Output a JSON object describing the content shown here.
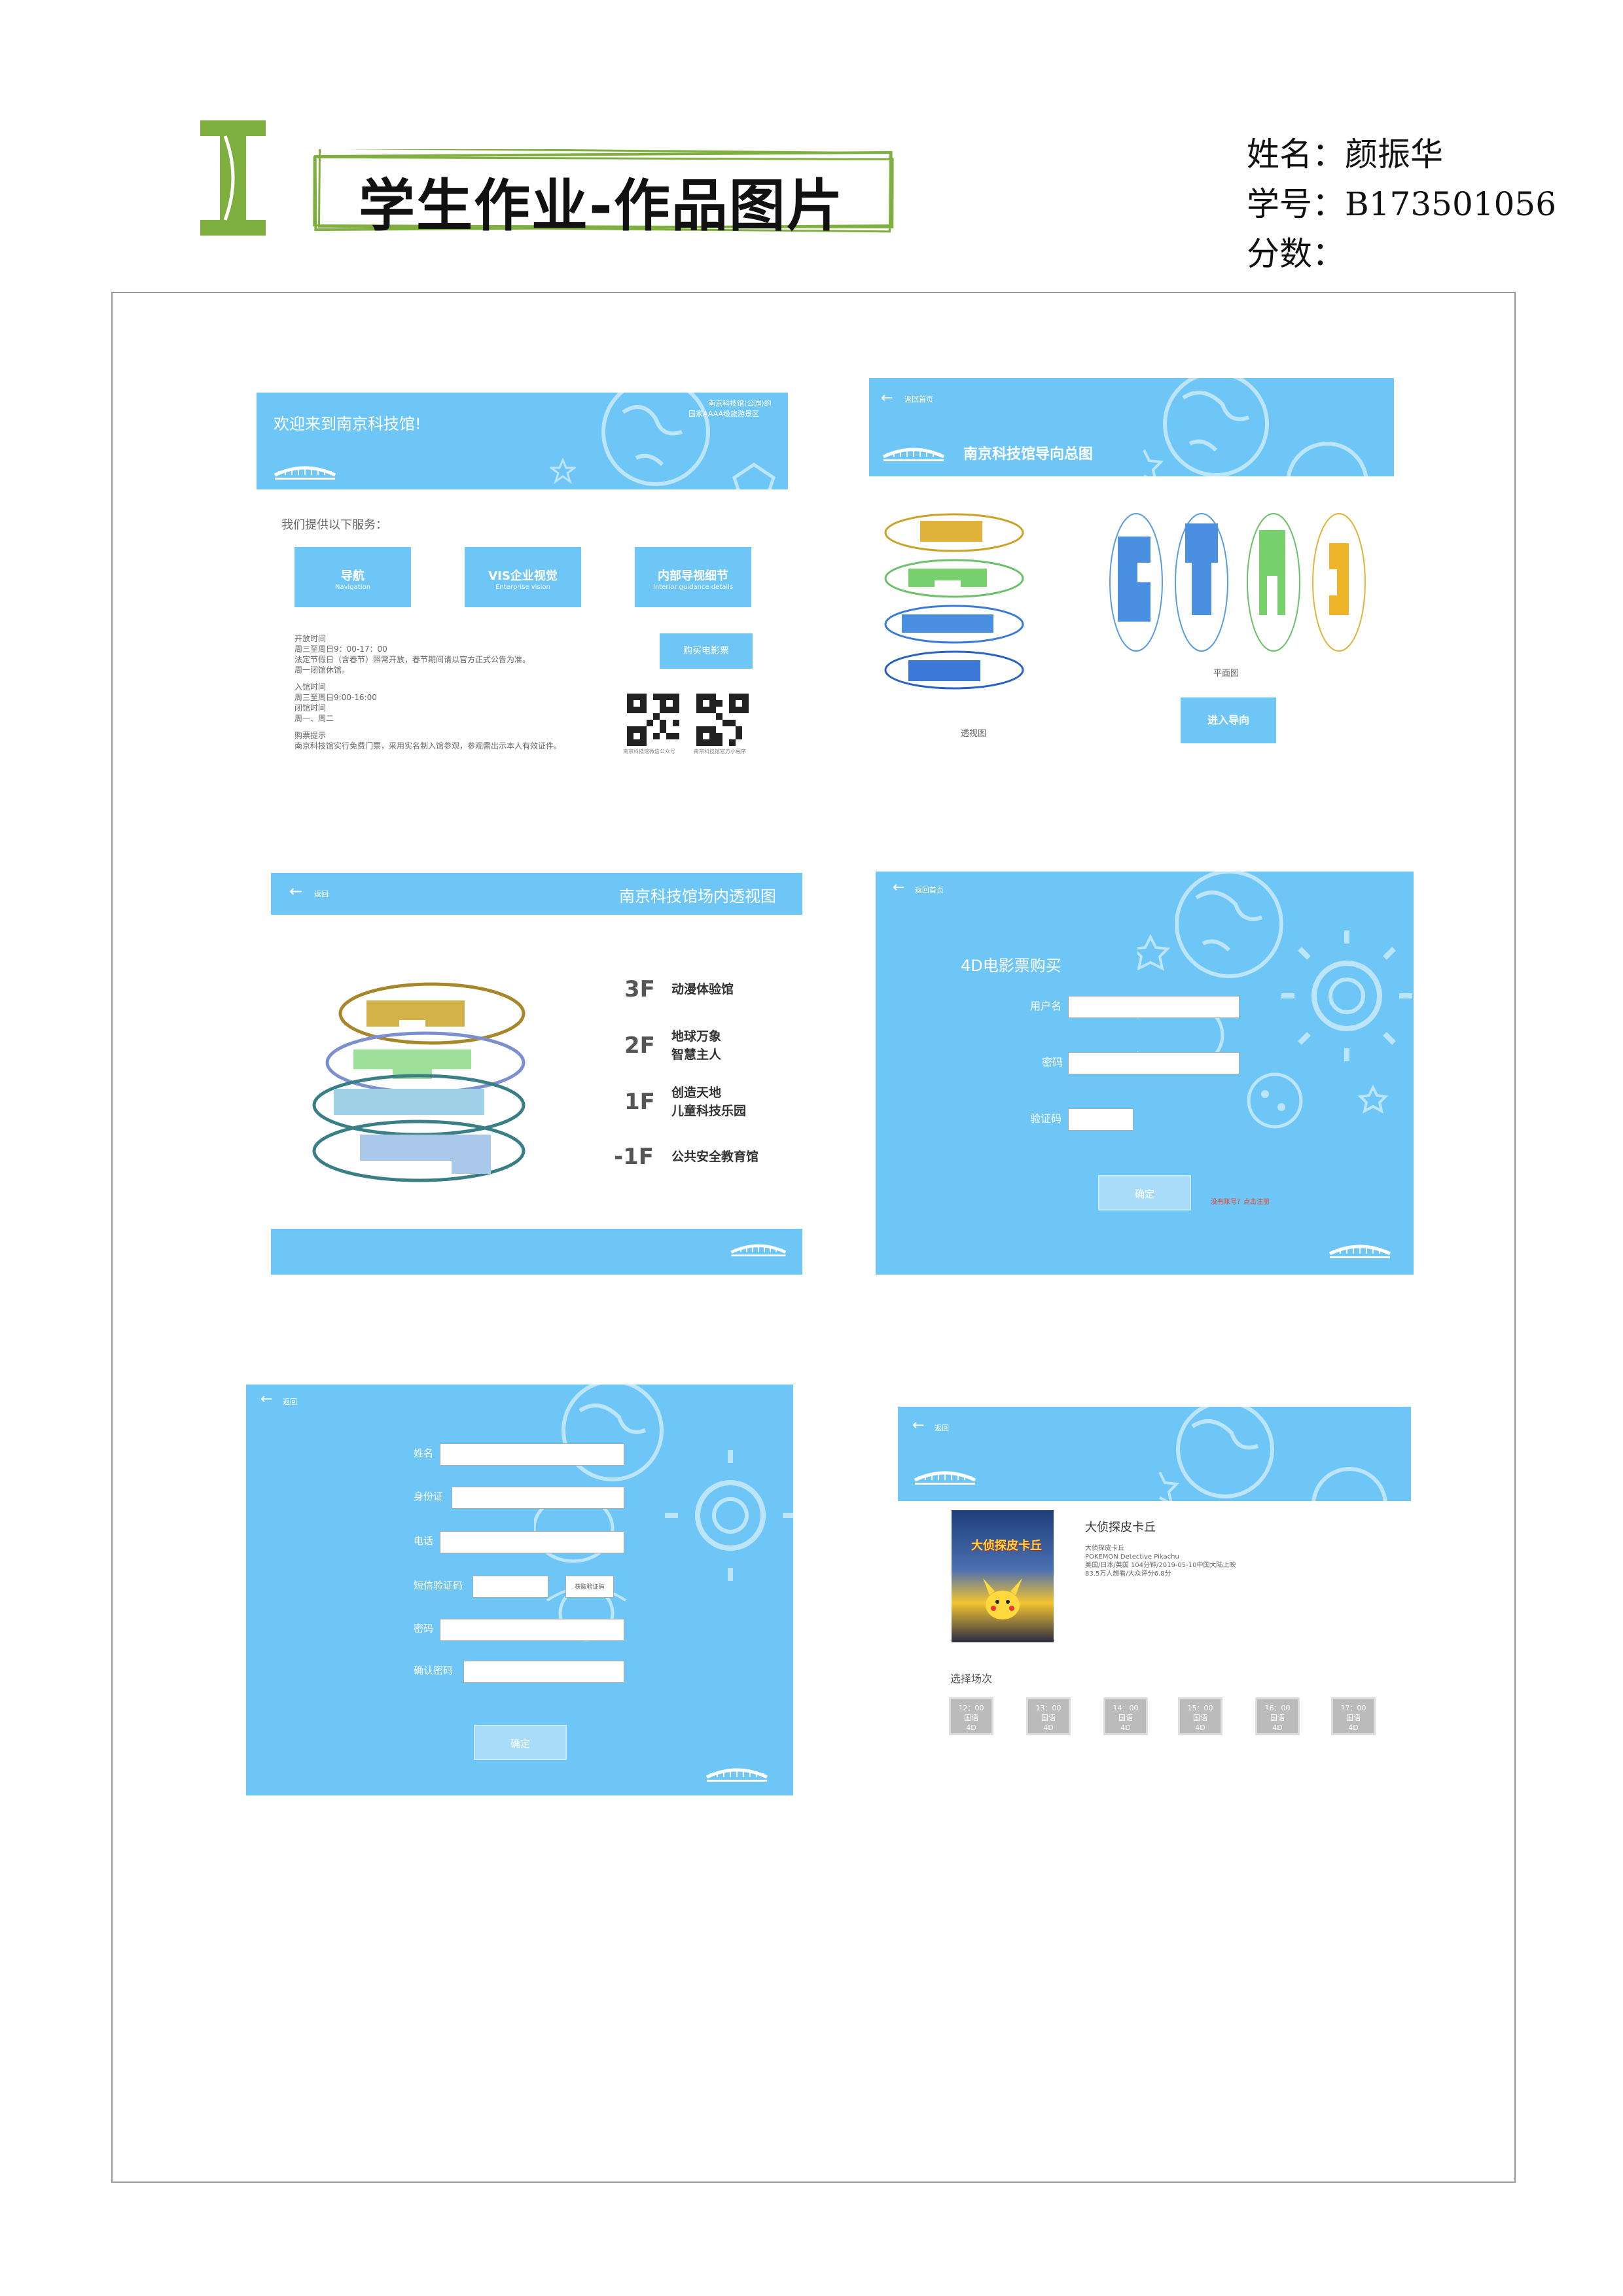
{
  "header": {
    "title": "学生作业-作品图片",
    "name_line": "姓名：颜振华",
    "id_line": "学号：B173501056",
    "score_line": "分数："
  },
  "screen1": {
    "welcome": "欢迎来到南京科技馆!",
    "corner_text_1": "南京科技馆(公园)的",
    "corner_text_2": "国家AAAA级旅游景区",
    "services_title": "我们提供以下服务：",
    "btn_nav_cn": "导航",
    "btn_nav_en": "Navigation",
    "btn_vis_cn": "VIS企业视觉",
    "btn_vis_en": "Enterprise vision",
    "btn_inner_cn": "内部导视细节",
    "btn_inner_en": "Interior guidance details",
    "btn_ticket": "购买电影票",
    "info_lines": [
      "开放时间",
      "周三至周日9：00-17：00",
      "法定节假日（含春节）照常开放，春节期间请以官方正式公告为准。",
      "周一闭馆休馆。",
      "",
      "入馆时间",
      "周三至周日9:00-16:00",
      "闭馆时间",
      "周一、周二",
      "",
      "购票提示",
      "南京科技馆实行免费门票，采用实名制入馆参观，参观需出示本人有效证件。"
    ],
    "qr_caption_1": "南京科技馆微信公众号",
    "qr_caption_2": "南京科技馆官方小程序"
  },
  "screen2": {
    "back": "返回首页",
    "title": "南京科技馆导向总图",
    "caption_left": "透视图",
    "caption_right": "平面图",
    "enter_btn": "进入导向"
  },
  "screen3": {
    "back": "返回",
    "title": "南京科技馆场内透视图",
    "floors": [
      {
        "level": "3F",
        "desc": [
          "动漫体验馆"
        ]
      },
      {
        "level": "2F",
        "desc": [
          "地球万象",
          "智慧主人"
        ]
      },
      {
        "level": "1F",
        "desc": [
          "创造天地",
          "儿童科技乐园"
        ]
      },
      {
        "level": "-1F",
        "desc": [
          "公共安全教育馆"
        ]
      }
    ]
  },
  "screen4": {
    "back": "返回首页",
    "title": "4D电影票购买",
    "username_label": "用户名",
    "password_label": "密码",
    "captcha_label": "验证码",
    "confirm_btn": "确定",
    "hint": "没有账号？点击注册"
  },
  "screen5": {
    "back": "返回",
    "name_label": "姓名",
    "idcard_label": "身份证",
    "phone_label": "电话",
    "sms_label": "短信验证码",
    "sms_btn": "获取验证码",
    "password_label": "密码",
    "confirm_password_label": "确认密码",
    "confirm_btn": "确定"
  },
  "screen6": {
    "back": "返回",
    "movie_title": "大侦探皮卡丘",
    "poster_text": "大侦探皮卡丘",
    "movie_info": [
      "大侦探皮卡丘",
      "POKEMON Detective Pikachu",
      "美国/日本/英国 104分钟/2019-05-10中国大陆上映",
      "83.5万人想看/大众评分6.8分"
    ],
    "choose_session": "选择场次",
    "sessions": [
      {
        "time": "12：00",
        "lang": "国语",
        "format": "4D"
      },
      {
        "time": "13：00",
        "lang": "国语",
        "format": "4D"
      },
      {
        "time": "14：00",
        "lang": "国语",
        "format": "4D"
      },
      {
        "time": "15：00",
        "lang": "国语",
        "format": "4D"
      },
      {
        "time": "16：00",
        "lang": "国语",
        "format": "4D"
      },
      {
        "time": "17：00",
        "lang": "国语",
        "format": "4D"
      }
    ]
  },
  "logo_text": "南京科技馆",
  "colors": {
    "panel_blue": "#6ec6f6",
    "accent_green": "#7fb03f",
    "hint_red": "#e8452c"
  }
}
